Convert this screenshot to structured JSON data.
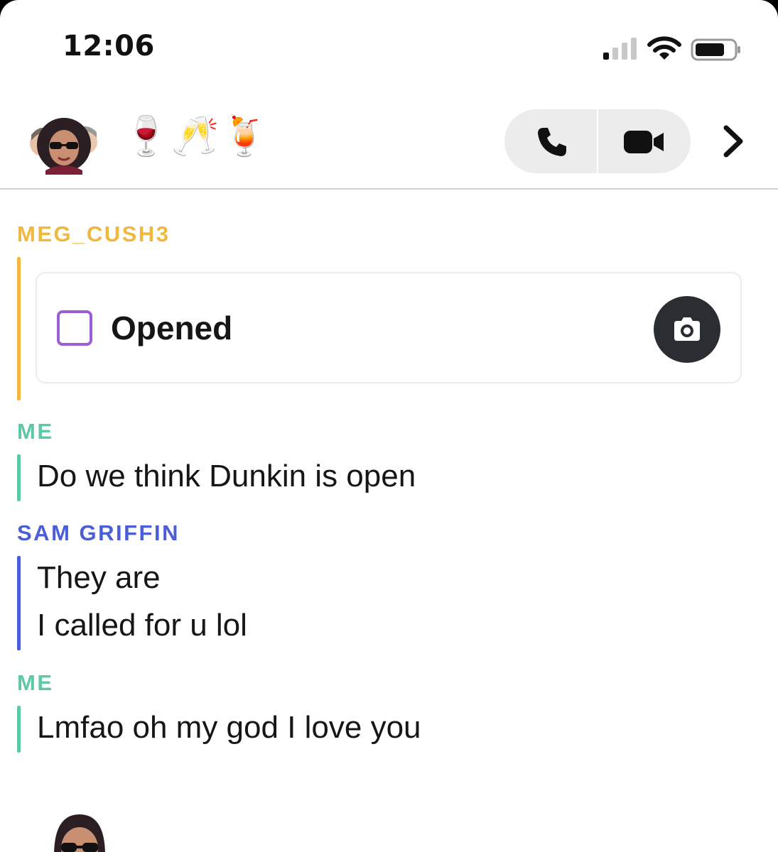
{
  "status_bar": {
    "time": "12:06",
    "signal_icon": "cellular-signal-icon",
    "wifi_icon": "wifi-icon",
    "battery_icon": "battery-icon"
  },
  "header": {
    "group_avatar": "bitmoji-group-avatar",
    "title": "🍷🥂🍹",
    "call_icon": "phone-icon",
    "video_icon": "video-camera-icon",
    "details_icon": "chevron-right-icon"
  },
  "colors": {
    "meg": "#f0b83f",
    "me": "#5cc9a3",
    "sam": "#4a5ed6",
    "snap_square": "#9b5ed6"
  },
  "messages": [
    {
      "sender": "MEG_CUSH3",
      "type": "snap",
      "status": "Opened",
      "action_icon": "camera-icon"
    },
    {
      "sender": "ME",
      "lines": [
        "Do we think Dunkin is open"
      ]
    },
    {
      "sender": "SAM GRIFFIN",
      "lines": [
        "They are",
        "I called for u lol"
      ]
    },
    {
      "sender": "ME",
      "lines": [
        "Lmfao oh my god I love you"
      ]
    }
  ]
}
